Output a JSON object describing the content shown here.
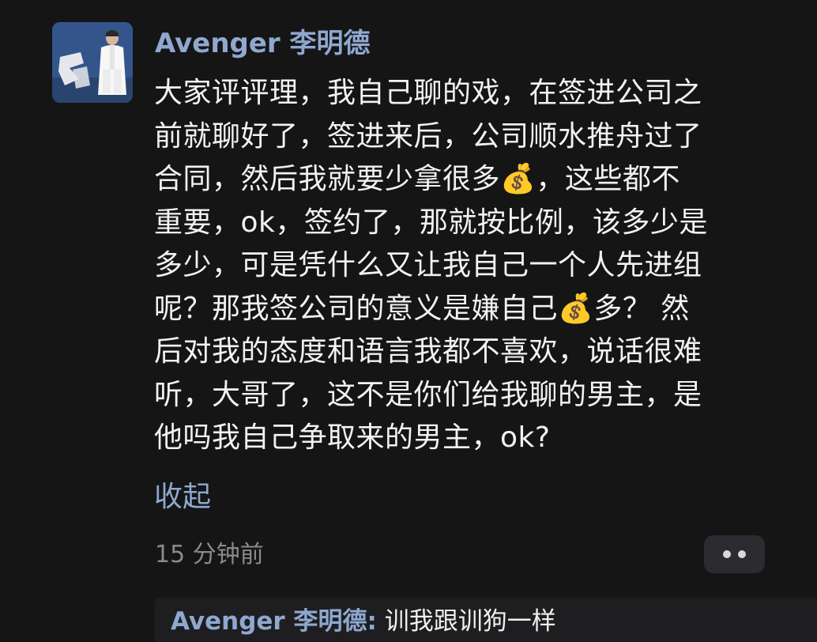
{
  "post": {
    "username": "Avenger 李明德",
    "text": "大家评评理，我自己聊的戏，在签进公司之\n前就聊好了，签进来后，公司顺水推舟过了\n合同，然后我就要少拿很多💰，这些都不\n重要，ok，签约了，那就按比例，该多少是\n多少，可是凭什么又让我自己一个人先进组\n呢？那我签公司的意义是嫌自己💰多？ 然\n后对我的态度和语言我都不喜欢，说话很难\n听，大哥了，这不是你们给我聊的男主，是\n他吗我自己争取来的男主，ok?",
    "collapse_label": "收起",
    "timestamp": "15 分钟前"
  },
  "reply": {
    "username": "Avenger 李明德",
    "separator": ":",
    "text": "训我跟训狗一样"
  },
  "icons": {
    "more": "more-dots-icon",
    "money": "money-bag-icon"
  },
  "colors": {
    "background": "#151516",
    "username": "#8fa8cf",
    "text": "#f2f2f2",
    "muted": "#8a8a8e"
  }
}
